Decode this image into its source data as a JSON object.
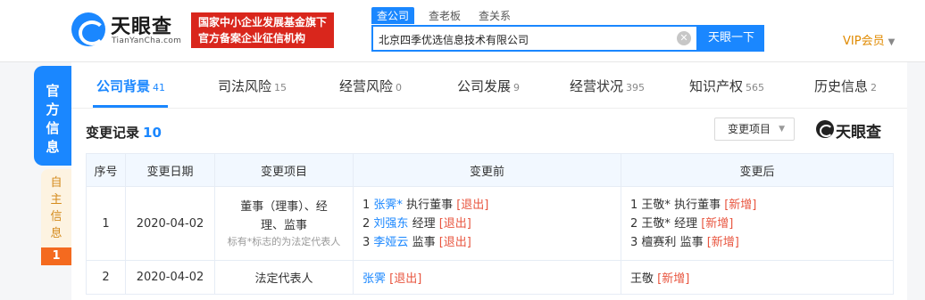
{
  "header": {
    "logo_text": "天眼查",
    "logo_sub": "TianYanCha.com",
    "badge_line1": "国家中小企业发展基金旗下",
    "badge_line2": "官方备案企业征信机构",
    "search_tabs": [
      "查公司",
      "查老板",
      "查关系"
    ],
    "search_value": "北京四季优选信息技术有限公司",
    "search_button": "天眼一下",
    "vip_label": "VIP会员"
  },
  "side": {
    "active_label": [
      "官",
      "方",
      "信",
      "息"
    ],
    "inactive_label": [
      "自",
      "主",
      "信",
      "息"
    ],
    "inactive_count": "1"
  },
  "tabs": [
    {
      "label": "公司背景",
      "count": "41"
    },
    {
      "label": "司法风险",
      "count": "15"
    },
    {
      "label": "经营风险",
      "count": "0"
    },
    {
      "label": "公司发展",
      "count": "9"
    },
    {
      "label": "经营状况",
      "count": "395"
    },
    {
      "label": "知识产权",
      "count": "565"
    },
    {
      "label": "历史信息",
      "count": "2"
    }
  ],
  "section": {
    "title": "变更记录",
    "count": "10",
    "filter_label": "变更项目",
    "watermark": "天眼查"
  },
  "table": {
    "headers": [
      "序号",
      "变更日期",
      "变更项目",
      "变更前",
      "变更后"
    ],
    "rows": [
      {
        "no": "1",
        "date": "2020-04-02",
        "item_line1": "董事（理事）、经",
        "item_line2": "理、监事",
        "item_note": "标有*标志的为法定代表人",
        "before": [
          {
            "idx": "1",
            "name": "张霁*",
            "role": "执行董事",
            "tag": "[退出]"
          },
          {
            "idx": "2",
            "name": "刘强东",
            "role": "经理",
            "tag": "[退出]"
          },
          {
            "idx": "3",
            "name": "李娅云",
            "role": "监事",
            "tag": "[退出]"
          }
        ],
        "after": [
          {
            "idx": "1",
            "name": "王敬*",
            "role": "执行董事",
            "tag": "[新增]"
          },
          {
            "idx": "2",
            "name": "王敬*",
            "role": "经理",
            "tag": "[新增]"
          },
          {
            "idx": "3",
            "name": "檀赛利",
            "role": "监事",
            "tag": "[新增]"
          }
        ]
      },
      {
        "no": "2",
        "date": "2020-04-02",
        "item_line1": "法定代表人",
        "before": {
          "name": "张霁",
          "tag": "[退出]"
        },
        "after": {
          "name": "王敬",
          "tag": "[新增]"
        }
      }
    ]
  },
  "colors": {
    "accent": "#1a87ff",
    "badge": "#d9261c",
    "tag": "#e8553f",
    "vip": "#e08a00"
  }
}
